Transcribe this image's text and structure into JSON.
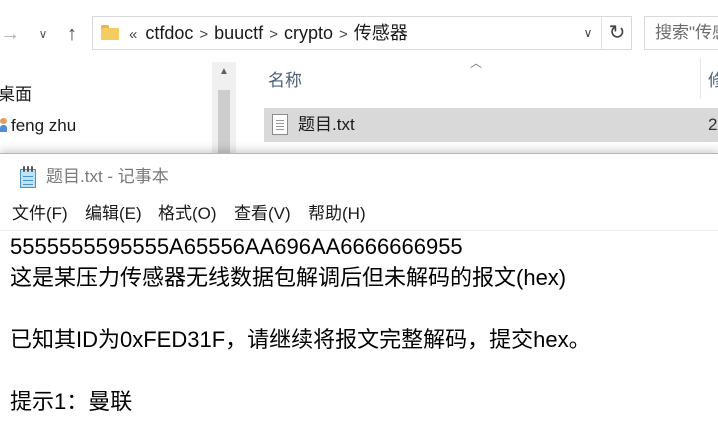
{
  "explorer": {
    "nav": {
      "back_glyph": "→",
      "history_glyph": "∨",
      "up_glyph": "↑"
    },
    "address": {
      "lead": "«",
      "crumbs": [
        "ctfdoc",
        "buuctf",
        "crypto",
        "传感器"
      ],
      "separator": ">",
      "dropdown_glyph": "∨",
      "refresh_glyph": "↻"
    },
    "search_placeholder": "搜索\"传感",
    "nav_pane": {
      "items": [
        {
          "label": "桌面"
        },
        {
          "label": "feng zhu"
        }
      ]
    },
    "columns": {
      "name": "名称",
      "next": "修"
    },
    "files": [
      {
        "name": "题目.txt",
        "date_fragment": "2"
      }
    ]
  },
  "notepad": {
    "title": "题目.txt - 记事本",
    "menu": [
      "文件(F)",
      "编辑(E)",
      "格式(O)",
      "查看(V)",
      "帮助(H)"
    ],
    "content": [
      "5555555595555A65556AA696AA6666666955",
      "这是某压力传感器无线数据包解调后但未解码的报文(hex)",
      "",
      "已知其ID为0xFED31F，请继续将报文完整解码，提交hex。",
      "",
      "提示1：曼联"
    ]
  },
  "colors": {
    "selection": "#d9d9d9",
    "header_text": "#4c607a",
    "folder": "#f4cc5f"
  }
}
